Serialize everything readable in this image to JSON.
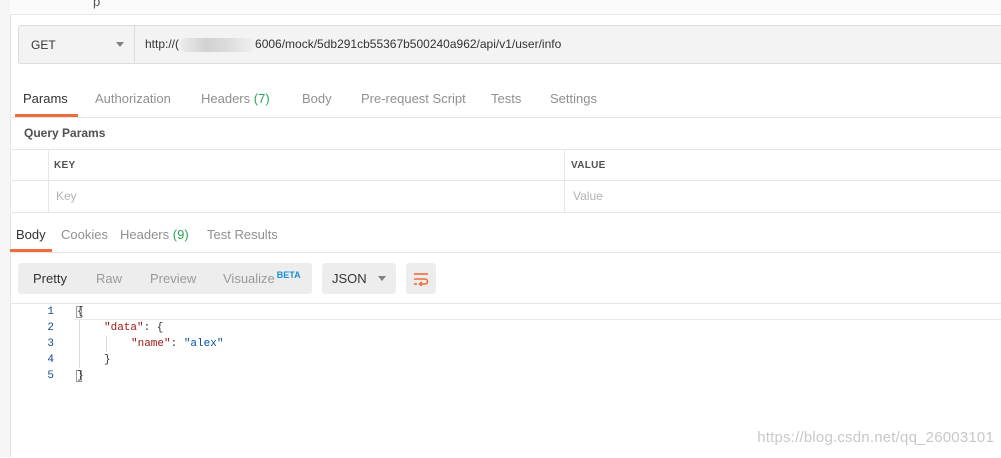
{
  "request": {
    "method": "GET",
    "url_prefix": "http://(",
    "url_suffix": "6006/mock/5db291cb55367b500240a962/api/v1/user/info"
  },
  "request_tabs": [
    {
      "label": "Params",
      "badge": ""
    },
    {
      "label": "Authorization",
      "badge": ""
    },
    {
      "label": "Headers",
      "badge": "(7)"
    },
    {
      "label": "Body",
      "badge": ""
    },
    {
      "label": "Pre-request Script",
      "badge": ""
    },
    {
      "label": "Tests",
      "badge": ""
    },
    {
      "label": "Settings",
      "badge": ""
    }
  ],
  "params": {
    "section_title": "Query Params",
    "key_header": "KEY",
    "value_header": "VALUE",
    "key_placeholder": "Key",
    "value_placeholder": "Value"
  },
  "response_tabs": [
    {
      "label": "Body",
      "badge": ""
    },
    {
      "label": "Cookies",
      "badge": ""
    },
    {
      "label": "Headers",
      "badge": "(9)"
    },
    {
      "label": "Test Results",
      "badge": ""
    }
  ],
  "view_modes": {
    "pretty": "Pretty",
    "raw": "Raw",
    "preview": "Preview",
    "visualize": "Visualize",
    "beta": "BETA"
  },
  "format_select": "JSON",
  "code_lines": [
    {
      "num": "1",
      "open": "{"
    },
    {
      "num": "2",
      "key": "\"data\"",
      "rest": ": {"
    },
    {
      "num": "3",
      "key": "\"name\"",
      "rest": ": ",
      "value": "\"alex\""
    },
    {
      "num": "4",
      "close": "}"
    },
    {
      "num": "5",
      "close": "}"
    }
  ],
  "watermark": "https://blog.csdn.net/qq_26003101",
  "colors": {
    "accent": "#f26b3a",
    "badge": "#26a65b",
    "json_key": "#a31515",
    "json_string": "#0451a5"
  }
}
